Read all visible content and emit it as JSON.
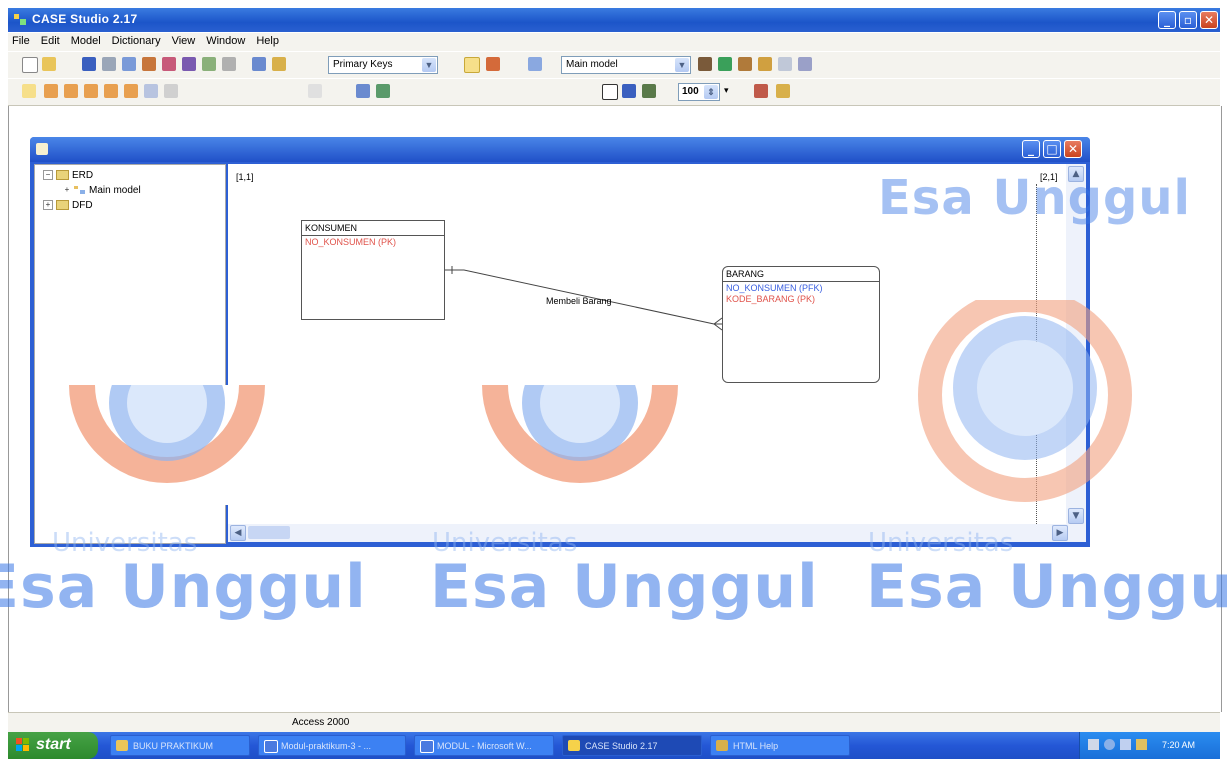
{
  "app": {
    "title": "CASE Studio 2.17"
  },
  "menu": [
    "File",
    "Edit",
    "Model",
    "Dictionary",
    "View",
    "Window",
    "Help"
  ],
  "toolbar": {
    "keys_combo": "Primary Keys",
    "model_combo": "Main model",
    "zoom": "100"
  },
  "tree": {
    "erd": "ERD",
    "main_model": "Main model",
    "dfd": "DFD"
  },
  "canvas": {
    "page_left": "[1,1]",
    "page_right": "[2,1]",
    "relationship": "Membeli Barang"
  },
  "entities": {
    "konsumen": {
      "name": "KONSUMEN",
      "attrs": [
        "NO_KONSUMEN (PK)"
      ]
    },
    "barang": {
      "name": "BARANG",
      "attrs": [
        "NO_KONSUMEN (PFK)",
        "KODE_BARANG (PK)"
      ]
    }
  },
  "colors": {
    "pk": "#e0524a",
    "pfk": "#3a5fe0",
    "watermark": "#3a78e6",
    "accent_orange": "#f29a77"
  },
  "watermark": {
    "text": "Esa Unggul",
    "small": "Universitas"
  },
  "status": {
    "text": "Access 2000"
  },
  "taskbar": {
    "start": "start",
    "tasks": [
      "BUKU PRAKTIKUM",
      "Modul-praktikum-3 - ...",
      "MODUL - Microsoft W...",
      "CASE Studio 2.17",
      "HTML Help"
    ],
    "clock": "7:20 AM"
  }
}
